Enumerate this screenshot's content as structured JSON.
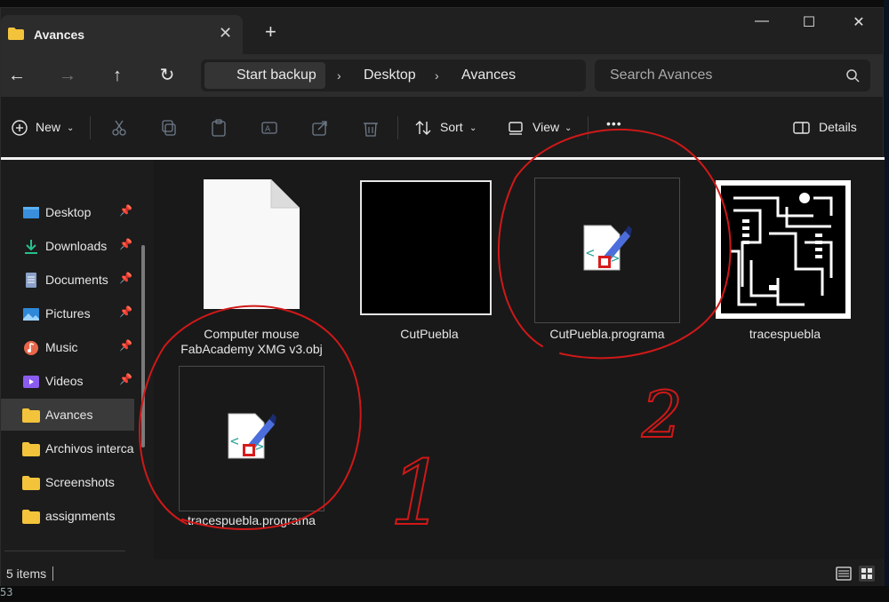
{
  "window": {
    "tab_title": "Avances",
    "close_tab": "✕",
    "new_tab": "+",
    "minimize": "—",
    "maximize": "☐",
    "close": "✕"
  },
  "nav": {
    "back": "←",
    "forward": "→",
    "up": "↑",
    "refresh": "↻",
    "breadcrumb": [
      "Start backup",
      "Desktop",
      "Avances"
    ],
    "search_placeholder": "Search Avances"
  },
  "commands": {
    "new": "New",
    "sort": "Sort",
    "view": "View",
    "more": "•••",
    "details": "Details"
  },
  "sidebar": {
    "items": [
      {
        "label": "Desktop",
        "icon": "desktop-icon",
        "pinned": true
      },
      {
        "label": "Downloads",
        "icon": "download-icon",
        "pinned": true
      },
      {
        "label": "Documents",
        "icon": "document-icon",
        "pinned": true
      },
      {
        "label": "Pictures",
        "icon": "pictures-icon",
        "pinned": true
      },
      {
        "label": "Music",
        "icon": "music-icon",
        "pinned": true
      },
      {
        "label": "Videos",
        "icon": "video-icon",
        "pinned": true
      },
      {
        "label": "Avances",
        "icon": "folder-icon",
        "pinned": false,
        "active": true
      },
      {
        "label": "Archivos interca",
        "icon": "folder-icon",
        "pinned": false
      },
      {
        "label": "Screenshots",
        "icon": "folder-icon",
        "pinned": false
      },
      {
        "label": "assignments",
        "icon": "folder-icon",
        "pinned": false
      }
    ]
  },
  "files": {
    "f1_line1": "Computer mouse",
    "f1_line2": "FabAcademy XMG v3.obj",
    "f2": "CutPuebla",
    "f3": "CutPuebla.programa",
    "f4": "tracespuebla",
    "f5": "tracespuebla.programa"
  },
  "status": {
    "count": "5 items"
  },
  "bottom_text": "53",
  "annotations": {
    "one": "1",
    "two": "2",
    "color": "#d01818"
  }
}
